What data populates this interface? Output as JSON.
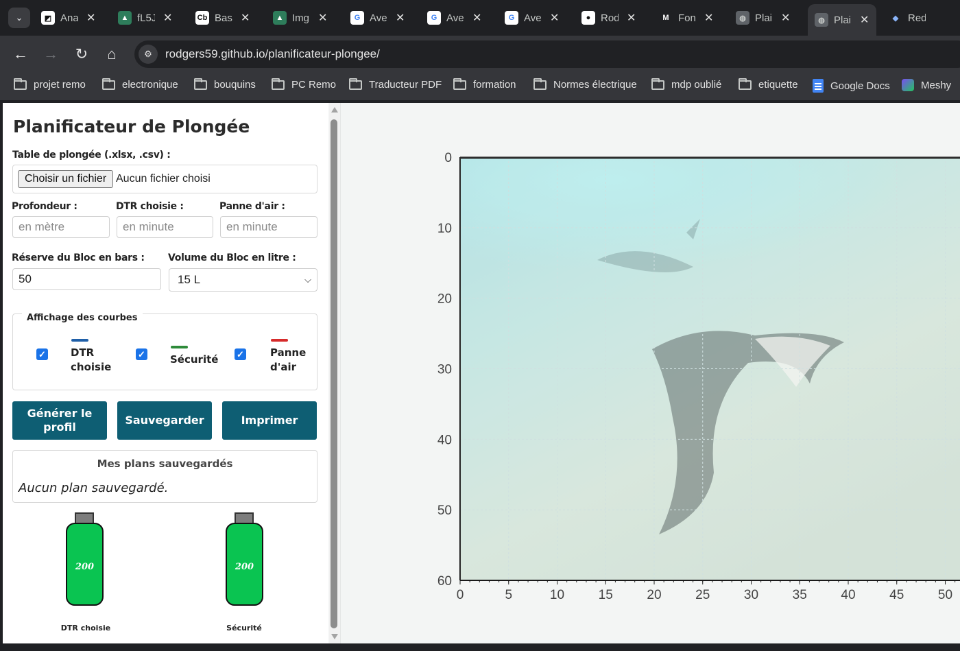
{
  "browser": {
    "tabs": [
      {
        "title": "Ana",
        "icon": "cursor-app-icon",
        "fav_bg": "#ffffff",
        "fav_fg": "#111111",
        "glyph": "◩"
      },
      {
        "title": "fL5J",
        "icon": "image-ai-icon",
        "fav_bg": "#2e7d5b",
        "fav_fg": "#ffffff",
        "glyph": "▲"
      },
      {
        "title": "Bas",
        "icon": "cb-icon",
        "fav_bg": "#ffffff",
        "fav_fg": "#111111",
        "glyph": "Cb"
      },
      {
        "title": "Img",
        "icon": "image-ai-icon",
        "fav_bg": "#2e7d5b",
        "fav_fg": "#ffffff",
        "glyph": "▲"
      },
      {
        "title": "Ave",
        "icon": "google-icon",
        "fav_bg": "#ffffff",
        "fav_fg": "#4285f4",
        "glyph": "G"
      },
      {
        "title": "Ave",
        "icon": "google-icon",
        "fav_bg": "#ffffff",
        "fav_fg": "#4285f4",
        "glyph": "G"
      },
      {
        "title": "Ave",
        "icon": "google-icon",
        "fav_bg": "#ffffff",
        "fav_fg": "#4285f4",
        "glyph": "G"
      },
      {
        "title": "Rod",
        "icon": "github-icon",
        "fav_bg": "#ffffff",
        "fav_fg": "#111111",
        "glyph": "●"
      },
      {
        "title": "Fon",
        "icon": "medium-icon",
        "fav_bg": "#1f2023",
        "fav_fg": "#ffffff",
        "glyph": "M"
      },
      {
        "title": "Plai",
        "icon": "globe-icon",
        "fav_bg": "#5f6368",
        "fav_fg": "#c4c7c5",
        "glyph": "◍"
      },
      {
        "title": "Plai",
        "icon": "globe-icon",
        "fav_bg": "#5f6368",
        "fav_fg": "#c4c7c5",
        "glyph": "◍"
      },
      {
        "title": "Red",
        "icon": "gem-icon",
        "fav_bg": "#1f2023",
        "fav_fg": "#8ab4f8",
        "glyph": "◆"
      }
    ],
    "url": "rodgers59.github.io/planificateur-plongee/",
    "bookmarks": [
      "projet remo",
      "electronique",
      "bouquins",
      "PC Remo",
      "Traducteur PDF",
      "formation",
      "Normes électrique",
      "mdp oublié",
      "etiquette",
      "Google Docs",
      "Meshy"
    ]
  },
  "panel": {
    "title": "Planificateur de Plongée",
    "file_label": "Table de plongée (.xlsx, .csv) :",
    "file_button": "Choisir un fichier",
    "file_status": "Aucun fichier choisi",
    "depth_label": "Profondeur :",
    "depth_placeholder": "en mètre",
    "dtr_label": "DTR choisie :",
    "dtr_placeholder": "en minute",
    "air_label": "Panne d'air :",
    "air_placeholder": "en minute",
    "reserve_label": "Réserve du Bloc en bars :",
    "reserve_value": "50",
    "volume_label": "Volume du Bloc en litre :",
    "volume_value": "15 L",
    "curves_legend": "Affichage des courbes",
    "curves": [
      {
        "line1": "DTR",
        "line2": "choisie",
        "color": "#1f5fa8",
        "checked": true
      },
      {
        "line1": "Sécurité",
        "line2": "",
        "color": "#2e8b3a",
        "checked": true
      },
      {
        "line1": "Panne",
        "line2": "d'air",
        "color": "#d62b2b",
        "checked": true
      }
    ],
    "buttons": {
      "generate_1": "Générer le",
      "generate_2": "profil",
      "save": "Sauvegarder",
      "print": "Imprimer"
    },
    "saved_title": "Mes plans sauvegardés",
    "saved_empty": "Aucun plan sauvegardé.",
    "tanks": [
      {
        "value": "200",
        "label": "DTR choisie"
      },
      {
        "value": "200",
        "label": "Sécurité"
      }
    ]
  },
  "chart_data": {
    "type": "line",
    "y_ticks": [
      0,
      10,
      20,
      30,
      40,
      50,
      60
    ],
    "x_ticks": [
      0,
      5,
      10,
      15,
      20,
      25,
      30,
      35,
      40,
      45,
      50
    ],
    "ylim": [
      60,
      0
    ],
    "xlim": [
      0,
      50
    ],
    "y_inverted": true,
    "grid": true,
    "background": "underwater photo of manta rays over sandy seabed",
    "series": []
  }
}
